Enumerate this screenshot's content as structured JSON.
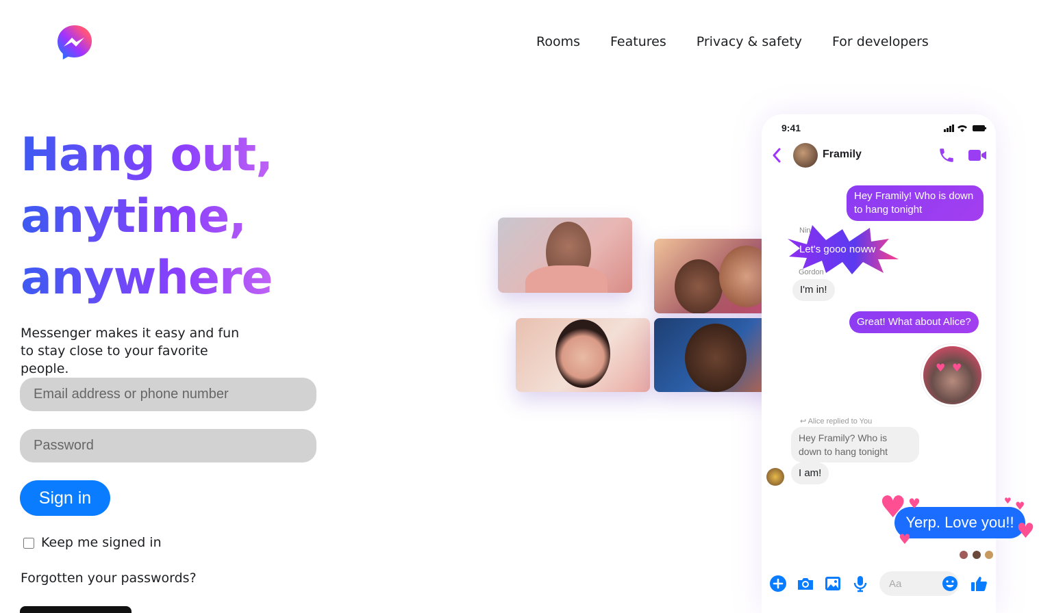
{
  "nav": {
    "items": [
      {
        "label": "Rooms"
      },
      {
        "label": "Features"
      },
      {
        "label": "Privacy & safety"
      },
      {
        "label": "For developers"
      }
    ]
  },
  "hero": {
    "headline": [
      "Hang out,",
      "anytime,",
      "anywhere"
    ],
    "subtitle": "Messenger makes it easy and fun to stay close to your favorite people."
  },
  "login": {
    "email_placeholder": "Email address or phone number",
    "password_placeholder": "Password",
    "signin_label": "Sign in",
    "keep_label": "Keep me signed in",
    "forgot_label": "Forgotten your passwords?"
  },
  "phone": {
    "time": "9:41",
    "chat_title": "Framily",
    "messages": {
      "m1": "Hey Framily! Who is down to hang tonight",
      "ning_name": "Ning",
      "m2": "Let's gooo noww",
      "gordon_name": "Gordon",
      "m3": "I'm in!",
      "m4": "Great! What about Alice?",
      "reply_note": "Alice replied to You",
      "m5": "Hey Framily? Who is down to hang tonight",
      "m6": "I am!",
      "m7": "Yerp. Love you!!"
    },
    "composer_placeholder": "Aa"
  },
  "colors": {
    "brand_blue": "#0a7cff",
    "bubble_purple": "#9b3df2",
    "love_blue": "#1a6dff"
  },
  "icons": [
    "messenger-logo",
    "back-icon",
    "call-icon",
    "video-icon",
    "plus-icon",
    "camera-icon",
    "gallery-icon",
    "microphone-icon",
    "emoji-icon",
    "thumbs-up-icon"
  ]
}
